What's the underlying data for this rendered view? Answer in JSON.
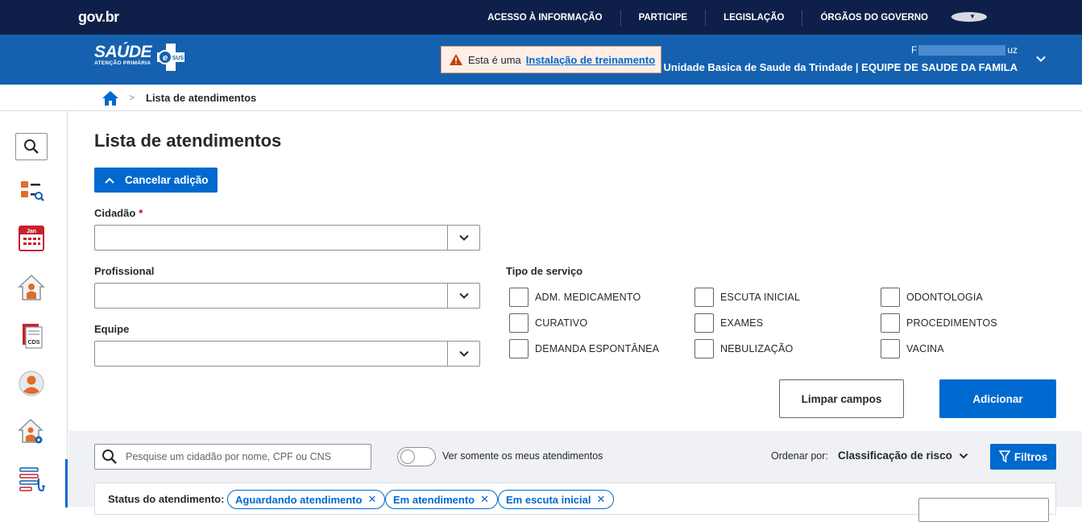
{
  "gov": {
    "logo": "gov.br",
    "links": [
      "ACESSO À INFORMAÇÃO",
      "PARTICIPE",
      "LEGISLAÇÃO",
      "ÓRGÃOS DO GOVERNO"
    ]
  },
  "header": {
    "brand_title": "SAÚDE",
    "brand_subtitle": "ATENÇÃO PRIMÁRIA",
    "brand_badge": "SUS",
    "training_prefix": "Esta é uma",
    "training_link": "Instalação de treinamento",
    "user_name_start": "F",
    "user_name_end": "uz",
    "user_unit": "Unidade Basica de Saude da Trindade | EQUIPE DE SAUDE DA FAMILA"
  },
  "breadcrumb": {
    "separator": ">",
    "current": "Lista de atendimentos"
  },
  "sidebar": {
    "items": [
      "search",
      "citizen-search",
      "calendar",
      "home-care",
      "cds",
      "user",
      "home-settings",
      "attendance-list"
    ],
    "calendar_month": "Jan",
    "cds_label": "CDS"
  },
  "page": {
    "title": "Lista de atendimentos",
    "cancel_button": "Cancelar adição",
    "cidadao_label": "Cidadão",
    "required_mark": "*",
    "profissional_label": "Profissional",
    "equipe_label": "Equipe",
    "tipo_servico_label": "Tipo de serviço",
    "services": [
      "ADM. MEDICAMENTO",
      "CURATIVO",
      "DEMANDA ESPONTÂNEA",
      "ESCUTA INICIAL",
      "EXAMES",
      "NEBULIZAÇÃO",
      "ODONTOLOGIA",
      "PROCEDIMENTOS",
      "VACINA"
    ],
    "clear_button": "Limpar campos",
    "add_button": "Adicionar"
  },
  "list_toolbar": {
    "search_placeholder": "Pesquise um cidadão por nome, CPF ou CNS",
    "toggle_label": "Ver somente os meus atendimentos",
    "order_label": "Ordenar por:",
    "order_value": "Classificação de risco",
    "filter_button": "Filtros",
    "status_label": "Status do atendimento:",
    "status_chips": [
      "Aguardando atendimento",
      "Em atendimento",
      "Em escuta inicial"
    ]
  },
  "colors": {
    "gov_bar": "#0e1f4a",
    "header": "#1561b0",
    "primary": "#0069d0",
    "warning_bg": "#fdeee6",
    "warning_icon": "#c2410c",
    "sidebar_accent": "#e06c2b",
    "sidebar_red": "#c8202f"
  }
}
